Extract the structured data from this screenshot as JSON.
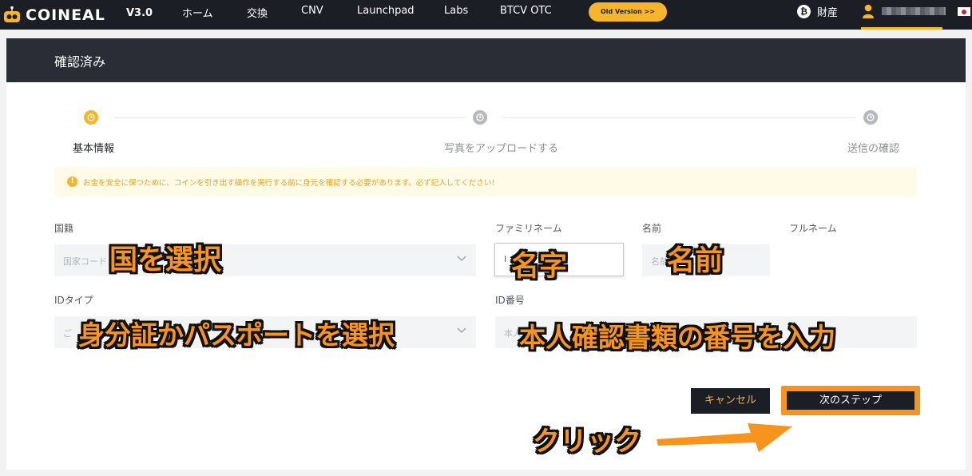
{
  "nav": {
    "logo_text": "COINEAL",
    "version": "V3.0",
    "items": [
      "ホーム",
      "交換",
      "CNV",
      "Launchpad",
      "Labs",
      "BTCV OTC"
    ],
    "old_version_button": "Old Version >>",
    "assets_label": "財産",
    "btc_glyph": "₿"
  },
  "panel": {
    "title": "確認済み"
  },
  "steps": [
    {
      "label": "基本情報",
      "state": "active"
    },
    {
      "label": "写真をアップロードする",
      "state": "inactive"
    },
    {
      "label": "送信の確認",
      "state": "inactive"
    }
  ],
  "notice": {
    "icon": "!",
    "text": "お金を安全に保つために、コインを引き出す操作を実行する前に身元を確認する必要があります。必ず記入してください！"
  },
  "form": {
    "nationality": {
      "label": "国籍",
      "placeholder": "国家コード"
    },
    "family_name": {
      "label": "ファミリネーム",
      "value": "I"
    },
    "given_name": {
      "label": "名前",
      "placeholder": "名前を入れ"
    },
    "full_name": {
      "label": "フルネーム"
    },
    "id_type": {
      "label": "IDタイプ",
      "placeholder": "ご"
    },
    "id_number": {
      "label": "ID番号",
      "placeholder": "本人"
    }
  },
  "buttons": {
    "cancel": "キャンセル",
    "next": "次のステップ"
  },
  "annotations": {
    "select_country": "国を選択",
    "surname": "名字",
    "given_name": "名前",
    "select_id": "身分証かパスポートを選択",
    "enter_number": "本人確認書類の番号を入力",
    "click": "クリック"
  },
  "colors": {
    "accent": "#f7b52b",
    "highlight": "#f7941d",
    "nav_bg": "#1c1e26"
  }
}
